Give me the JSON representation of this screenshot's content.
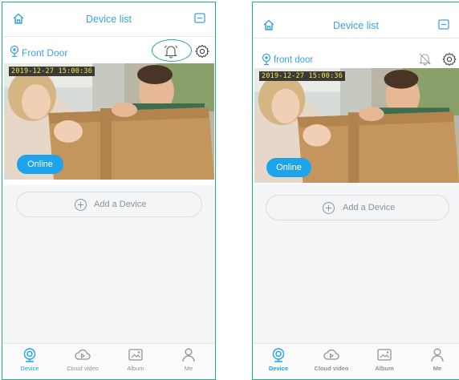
{
  "screens": [
    {
      "header": {
        "title": "Device list",
        "home_icon": "home-icon",
        "menu_icon": "menu-icon"
      },
      "device": {
        "name": "Front Door",
        "timestamp": "2019-12-27  15:00:36",
        "status": "Online",
        "bell_icon": "bell-icon",
        "settings_icon": "gear-icon",
        "bell_highlighted": true
      },
      "add_device": {
        "label": "Add a Device"
      },
      "tabs": [
        {
          "label": "Device",
          "icon": "webcam-icon",
          "active": true
        },
        {
          "label": "Cloud video",
          "icon": "cloud-play-icon",
          "active": false
        },
        {
          "label": "Album",
          "icon": "album-icon",
          "active": false
        },
        {
          "label": "Me",
          "icon": "person-icon",
          "active": false
        }
      ]
    },
    {
      "header": {
        "title": "Device list",
        "home_icon": "home-icon",
        "menu_icon": "menu-icon"
      },
      "device": {
        "name": "front door",
        "timestamp": "2019-12-27  15:00:36",
        "status": "Online",
        "bell_icon": "bell-off-icon",
        "settings_icon": "gear-icon",
        "bell_highlighted": false
      },
      "add_device": {
        "label": "Add a Device"
      },
      "tabs": [
        {
          "label": "Device",
          "icon": "webcam-icon",
          "active": true
        },
        {
          "label": "Cloud video",
          "icon": "cloud-play-icon",
          "active": false
        },
        {
          "label": "Album",
          "icon": "album-icon",
          "active": false
        },
        {
          "label": "Me",
          "icon": "person-icon",
          "active": false
        }
      ]
    }
  ],
  "colors": {
    "accent": "#1ea4ea",
    "title": "#3aa3dd",
    "frame": "#26a98a",
    "muted": "#8a9399"
  }
}
